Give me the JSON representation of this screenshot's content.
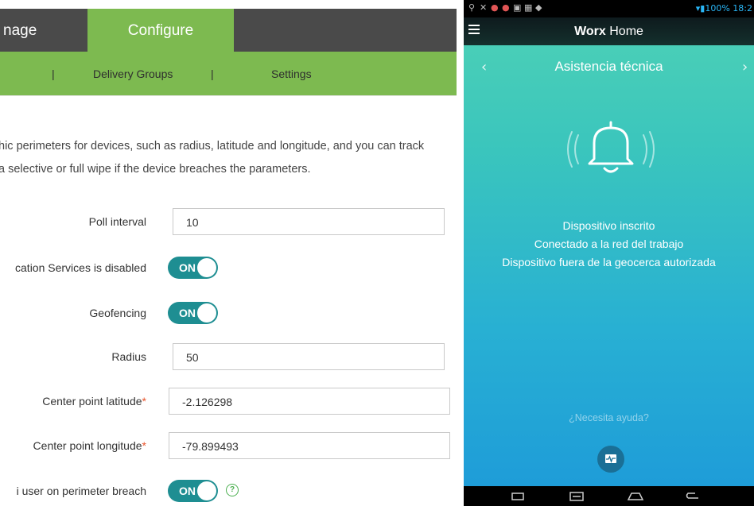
{
  "console": {
    "tabs": {
      "manage": "nage",
      "configure": "Configure"
    },
    "subnav": {
      "sep1": "|",
      "delivery_groups": "Delivery Groups",
      "sep2": "|",
      "settings": "Settings"
    },
    "description": [
      "hic perimeters for devices, such as radius, latitude and longitude, and you can track",
      "a selective or full wipe if the device breaches the parameters."
    ],
    "fields": {
      "poll_interval": {
        "label": "Poll interval",
        "value": "10"
      },
      "location_services": {
        "label": "cation Services is disabled",
        "toggle": "ON"
      },
      "geofencing": {
        "label": "Geofencing",
        "toggle": "ON"
      },
      "radius": {
        "label": "Radius",
        "value": "50"
      },
      "center_lat": {
        "label": "Center point latitude",
        "required": "*",
        "value": "-2.126298"
      },
      "center_lon": {
        "label": "Center point longitude",
        "required": "*",
        "value": "-79.899493"
      },
      "perimeter_breach": {
        "label": "i user on perimeter breach",
        "toggle": "ON",
        "help": "?"
      }
    },
    "colors": {
      "accent_green": "#7dba50",
      "toggle_teal": "#1e8e92",
      "topbar": "#4a4a4a",
      "required": "#e8542b"
    }
  },
  "device": {
    "statusbar": {
      "right": "100% 18:2"
    },
    "app": {
      "title_bold": "Worx",
      "title_rest": " Home"
    },
    "screen": {
      "prev": "‹",
      "title": "Asistencia técnica",
      "next": "›",
      "bell_icon": "bell-ringing-icon",
      "status_lines": [
        "Dispositivo inscrito",
        "Conectado a la red del trabajo",
        "Dispositivo fuera de la geocerca autorizada"
      ],
      "help_link": "¿Necesita ayuda?",
      "support_icon": "diagnostics-icon"
    },
    "navbar": [
      "recent-apps-icon",
      "screenshot-icon",
      "home-icon",
      "back-icon"
    ],
    "colors": {
      "gradient_top": "#4fd2b5",
      "gradient_bottom": "#1d9ad9",
      "button": "#1a6f96"
    }
  }
}
